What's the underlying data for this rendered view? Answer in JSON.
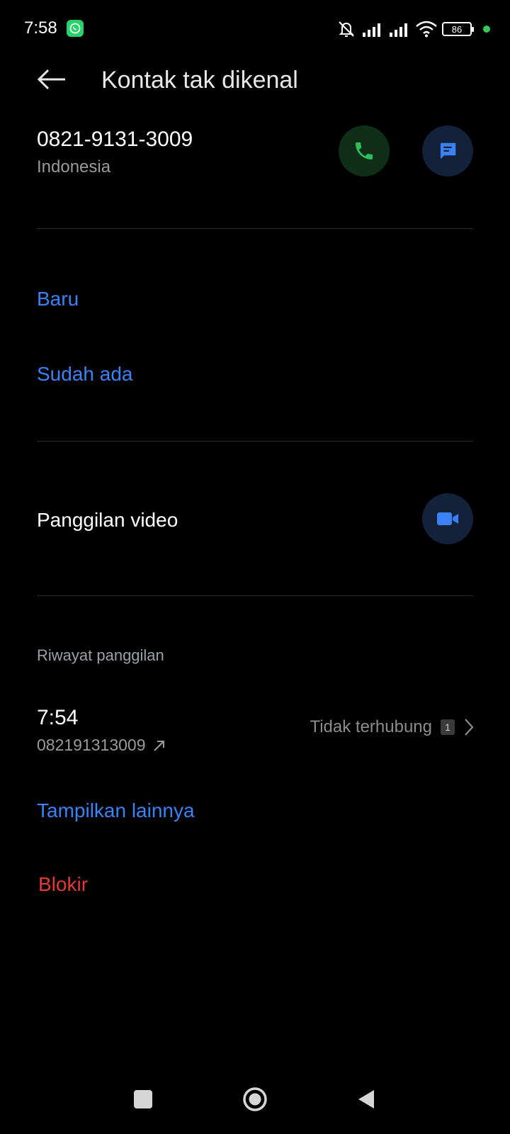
{
  "status_bar": {
    "time": "7:58",
    "battery": "86",
    "icons": [
      "whatsapp-icon",
      "mute-icon",
      "signal-icon",
      "signal-icon",
      "wifi-icon",
      "battery-icon"
    ]
  },
  "header": {
    "title": "Kontak tak dikenal"
  },
  "contact": {
    "number": "0821-9131-3009",
    "country": "Indonesia"
  },
  "add_contact": {
    "new_label": "Baru",
    "existing_label": "Sudah ada"
  },
  "video_call": {
    "label": "Panggilan video"
  },
  "history": {
    "section_label": "Riwayat panggilan",
    "entries": [
      {
        "time": "7:54",
        "number": "082191313009",
        "status": "Tidak terhubung",
        "sim": "1"
      }
    ],
    "more_label": "Tampilkan lainnya"
  },
  "actions": {
    "block_label": "Blokir"
  },
  "colors": {
    "accent_blue": "#3b82f6",
    "danger_red": "#e53935",
    "call_green": "#2fbf5a"
  }
}
